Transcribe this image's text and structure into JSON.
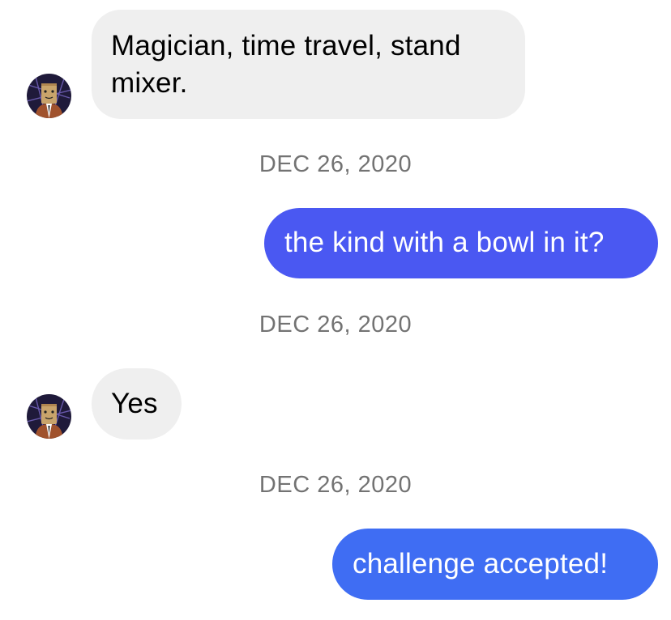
{
  "messages": [
    {
      "direction": "incoming",
      "text": "Magician, time travel, stand mixer."
    },
    {
      "timestamp": "DEC 26, 2020"
    },
    {
      "direction": "outgoing",
      "text": "the kind with a bowl in it?"
    },
    {
      "timestamp": "DEC 26, 2020"
    },
    {
      "direction": "incoming",
      "text": "Yes"
    },
    {
      "timestamp": "DEC 26, 2020"
    },
    {
      "direction": "outgoing",
      "text": "challenge accepted!"
    }
  ],
  "avatar_icon": "paper-bag-head-avatar",
  "colors": {
    "incoming_bubble": "#efefef",
    "outgoing_bubble_top": "#4a58f2",
    "outgoing_bubble_bottom": "#3f6df3",
    "timestamp_text": "#737373"
  }
}
